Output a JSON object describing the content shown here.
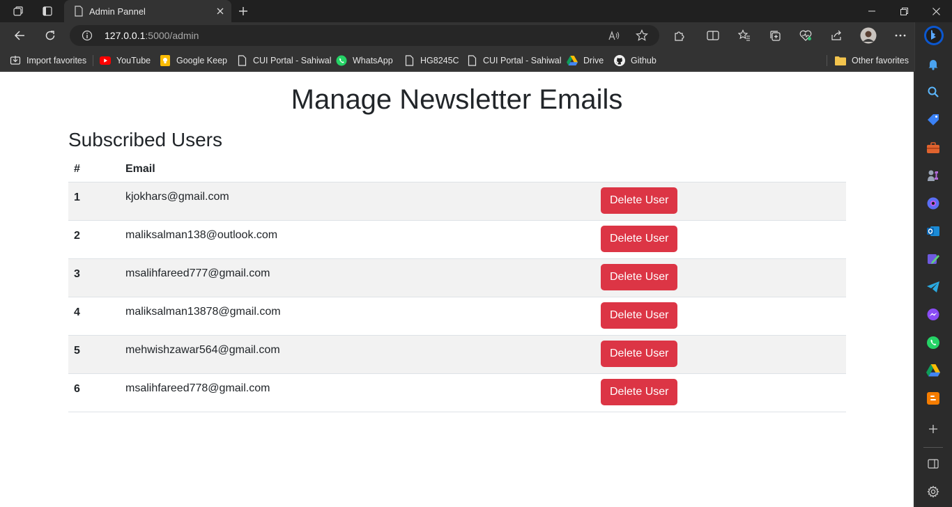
{
  "browser": {
    "tab": {
      "title": "Admin Pannel"
    },
    "url": {
      "host": "127.0.0.1",
      "path": ":5000/admin"
    },
    "favorites": [
      {
        "label": "Import favorites",
        "icon": "import-icon"
      },
      {
        "label": "YouTube",
        "icon": "youtube-icon"
      },
      {
        "label": "Google Keep",
        "icon": "keep-icon"
      },
      {
        "label": "CUI Portal - Sahiwal",
        "icon": "page-icon"
      },
      {
        "label": "WhatsApp",
        "icon": "whatsapp-icon"
      },
      {
        "label": "HG8245C",
        "icon": "page-icon"
      },
      {
        "label": "CUI Portal - Sahiwal",
        "icon": "page-icon"
      },
      {
        "label": "Drive",
        "icon": "drive-icon"
      },
      {
        "label": "Github",
        "icon": "github-icon"
      }
    ],
    "other_favorites": "Other favorites",
    "colors": {
      "accent": "#dc3545",
      "chrome": "#333333",
      "titlebar": "#202020"
    }
  },
  "page": {
    "title": "Manage Newsletter Emails",
    "section_title": "Subscribed Users",
    "table": {
      "headers": [
        "#",
        "Email",
        ""
      ],
      "rows": [
        {
          "num": "1",
          "email": "kjokhars@gmail.com",
          "action": "Delete User"
        },
        {
          "num": "2",
          "email": "maliksalman138@outlook.com",
          "action": "Delete User"
        },
        {
          "num": "3",
          "email": "msalihfareed777@gmail.com",
          "action": "Delete User"
        },
        {
          "num": "4",
          "email": "maliksalman13878@gmail.com",
          "action": "Delete User"
        },
        {
          "num": "5",
          "email": "mehwishzawar564@gmail.com",
          "action": "Delete User"
        },
        {
          "num": "6",
          "email": "msalihfareed778@gmail.com",
          "action": "Delete User"
        }
      ]
    }
  }
}
